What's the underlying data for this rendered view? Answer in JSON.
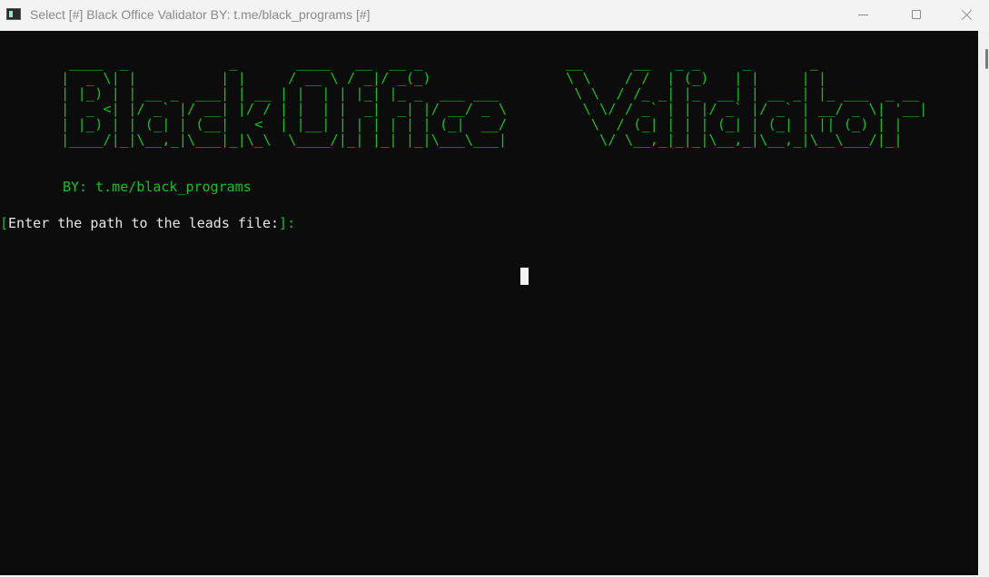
{
  "window": {
    "title": "Select [#] Black Office Validator BY: t.me/black_programs [#]",
    "icon": "terminal-icon",
    "controls": [
      "minimize-icon",
      "maximize-icon",
      "close-icon"
    ]
  },
  "console": {
    "banner": " ____  _            _       ____   __  __ _                 __      __   _ _     _       _             \n|  _ \\| |          | |     / __ \\ / _|/ _(_)                \\ \\    / /  | (_)   | |     | |            \n| |_) | | __ _  ___| | __ | |  | | |_| |_ _  ___ ___         \\ \\  / /_ _| |_  __| | __ _| |_ ___  _ __ \n|  _ <| |/ _` |/ __| |/ / | |  | |  _|  _| |/ __/ _ \\         \\ \\/ / _` | | |/ _` |/ _` | __/ _ \\| '__|\n| |_) | | (_| | (__|   <  | |__| | | | | | | (_|  __/          \\  / (_| | | | (_| | (_| | || (_) | |   \n|____/|_|\\__,_|\\___|_|\\_\\  \\____/|_| |_| |_|\\___\\___|           \\/ \\__,_|_|_|\\__,_|\\__,_|\\__\\___/|_|   ",
    "by_line": "BY: t.me/black_programs",
    "prompt_open": "[",
    "prompt_text": "Enter the path to the leads file:",
    "prompt_close": "]:"
  },
  "colors": {
    "background": "#0c0c0c",
    "accent": "#13c11f",
    "text": "#e6e6e6"
  }
}
